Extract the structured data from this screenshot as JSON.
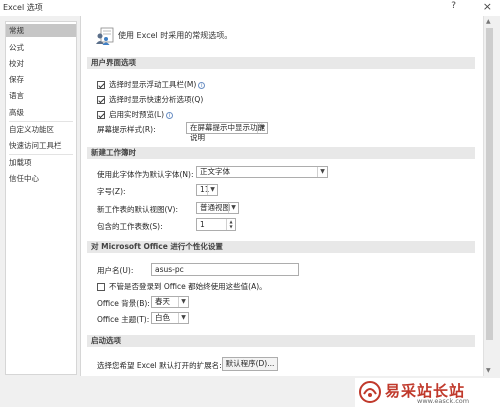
{
  "window": {
    "title": "Excel 选项",
    "help": "?",
    "close": "×"
  },
  "sidebar": {
    "items": [
      {
        "label": "常规",
        "active": true
      },
      {
        "label": "公式"
      },
      {
        "label": "校对"
      },
      {
        "label": "保存"
      },
      {
        "label": "语言"
      },
      {
        "label": "高级"
      },
      {
        "label": "自定义功能区"
      },
      {
        "label": "快速访问工具栏"
      },
      {
        "label": "加载项"
      },
      {
        "label": "信任中心"
      }
    ]
  },
  "header": {
    "text": "使用 Excel 时采用的常规选项。"
  },
  "ui_options": {
    "section_title": "用户界面选项",
    "mini_toolbar": "选择时显示浮动工具栏(M)",
    "quick_analysis": "选择时显示快速分析选项(Q)",
    "live_preview": "启用实时预览(L)",
    "screentip_label": "屏幕提示样式(R):",
    "screentip_value": "在屏幕提示中显示功能说明",
    "info_glyph": "i"
  },
  "new_workbook": {
    "section_title": "新建工作簿时",
    "font_label": "使用此字体作为默认字体(N):",
    "font_value": "正文字体",
    "size_label": "字号(Z):",
    "size_value": "11",
    "view_label": "新工作表的默认视图(V):",
    "view_value": "普通视图",
    "sheets_label": "包含的工作表数(S):",
    "sheets_value": "1"
  },
  "personalize": {
    "section_title": "对 Microsoft Office 进行个性化设置",
    "username_label": "用户名(U):",
    "username_value": "asus-pc",
    "always_use": "不管是否登录到 Office 都始终使用这些值(A)。",
    "background_label": "Office 背景(B):",
    "background_value": "春天",
    "theme_label": "Office 主题(T):",
    "theme_value": "白色"
  },
  "startup": {
    "section_title": "启动选项",
    "extensions_label": "选择您希望 Excel 默认打开的扩展名:",
    "default_programs_button": "默认程序(D)..."
  },
  "watermark": {
    "text": "易采站长站",
    "url": "www.easck.com"
  }
}
